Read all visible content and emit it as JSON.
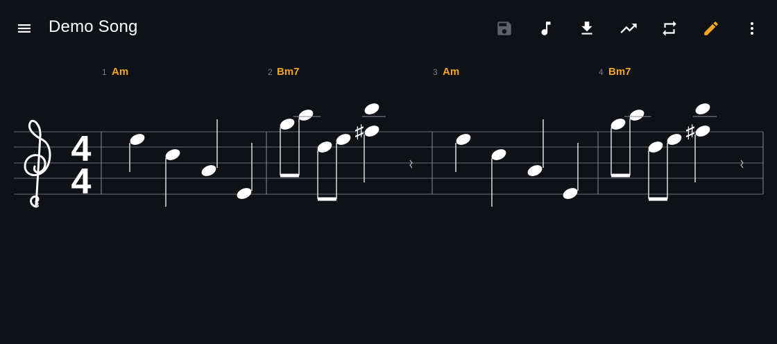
{
  "app": {
    "title": "Demo Song"
  },
  "toolbar": {
    "icons": [
      "menu-icon",
      "save-icon",
      "music-note-icon",
      "download-icon",
      "trending-up-icon",
      "repeat-icon",
      "pencil-icon",
      "more-vert-icon"
    ],
    "save_disabled": true,
    "accent_color": "#f5a623"
  },
  "score": {
    "clef": "treble-8vb",
    "time_signature": {
      "numerator": "4",
      "denominator": "4"
    },
    "measures": [
      {
        "number": "1",
        "chord": "Am"
      },
      {
        "number": "2",
        "chord": "Bm7"
      },
      {
        "number": "3",
        "chord": "Am"
      },
      {
        "number": "4",
        "chord": "Bm7"
      }
    ],
    "colors": {
      "chord": "#f5a623",
      "measure_number": "#7a7f87",
      "staff": "#6b6f76",
      "notes": "#ffffff"
    }
  }
}
